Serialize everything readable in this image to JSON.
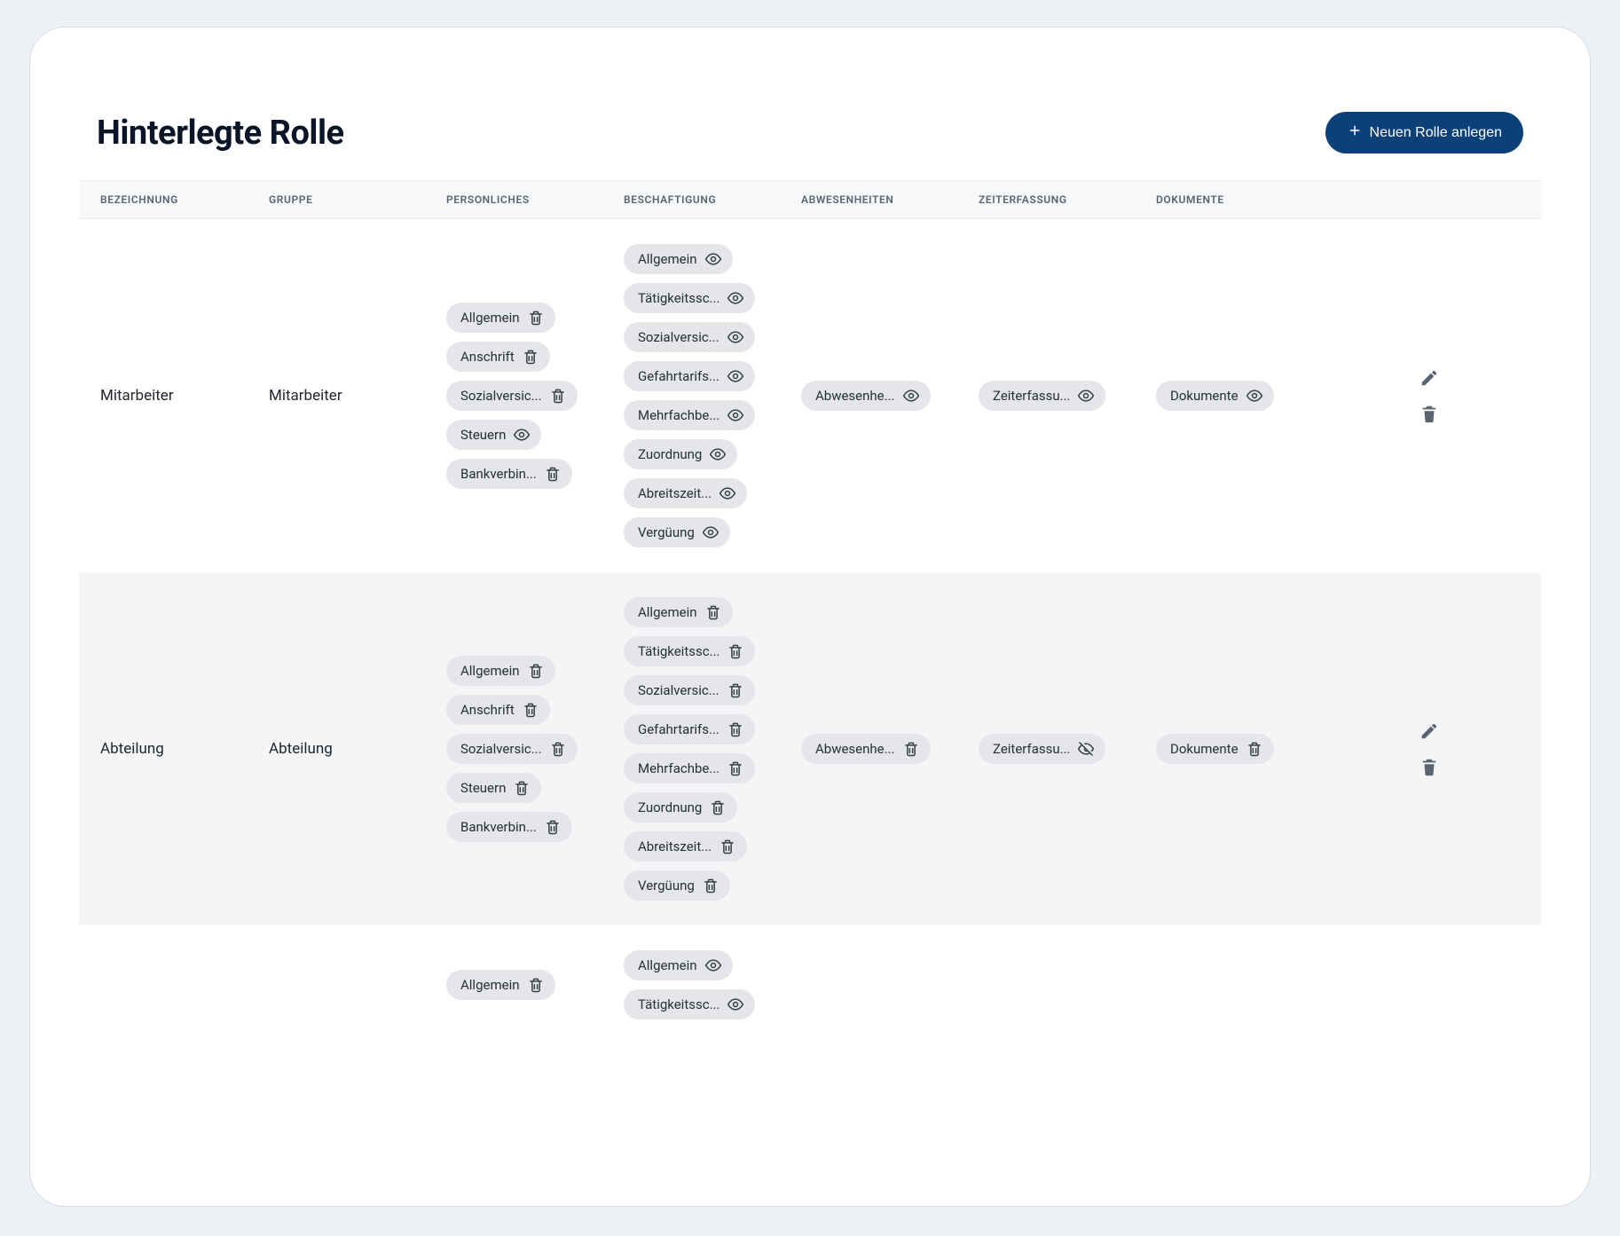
{
  "header": {
    "title": "Hinterlegte Rolle",
    "primaryButton": "Neuen Rolle anlegen"
  },
  "columns": [
    "BEZEICHNUNG",
    "GRUPPE",
    "PERSONLICHES",
    "BESCHAFTIGUNG",
    "ABWESENHEITEN",
    "ZEITERFASSUNG",
    "DOKUMENTE"
  ],
  "rows": [
    {
      "bezeichnung": "Mitarbeiter",
      "gruppe": "Mitarbeiter",
      "personliches": [
        {
          "label": "Allgemein",
          "icon": "trash"
        },
        {
          "label": "Anschrift",
          "icon": "trash"
        },
        {
          "label": "Sozialversic...",
          "icon": "trash"
        },
        {
          "label": "Steuern",
          "icon": "eye"
        },
        {
          "label": "Bankverbin...",
          "icon": "trash"
        }
      ],
      "beschaftigung": [
        {
          "label": "Allgemein",
          "icon": "eye"
        },
        {
          "label": "Tätigkeitssc...",
          "icon": "eye"
        },
        {
          "label": "Sozialversic...",
          "icon": "eye"
        },
        {
          "label": "Gefahrtarifs...",
          "icon": "eye"
        },
        {
          "label": "Mehrfachbe...",
          "icon": "eye"
        },
        {
          "label": "Zuordnung",
          "icon": "eye"
        },
        {
          "label": "Abreitszeit...",
          "icon": "eye"
        },
        {
          "label": "Vergüung",
          "icon": "eye"
        }
      ],
      "abwesenheiten": [
        {
          "label": "Abwesenhe...",
          "icon": "eye"
        }
      ],
      "zeiterfassung": [
        {
          "label": "Zeiterfassu...",
          "icon": "eye"
        }
      ],
      "dokumente": [
        {
          "label": "Dokumente",
          "icon": "eye"
        }
      ]
    },
    {
      "bezeichnung": "Abteilung",
      "gruppe": "Abteilung",
      "personliches": [
        {
          "label": "Allgemein",
          "icon": "trash"
        },
        {
          "label": "Anschrift",
          "icon": "trash"
        },
        {
          "label": "Sozialversic...",
          "icon": "trash"
        },
        {
          "label": "Steuern",
          "icon": "trash"
        },
        {
          "label": "Bankverbin...",
          "icon": "trash"
        }
      ],
      "beschaftigung": [
        {
          "label": "Allgemein",
          "icon": "trash"
        },
        {
          "label": "Tätigkeitssc...",
          "icon": "trash"
        },
        {
          "label": "Sozialversic...",
          "icon": "trash"
        },
        {
          "label": "Gefahrtarifs...",
          "icon": "trash"
        },
        {
          "label": "Mehrfachbe...",
          "icon": "trash"
        },
        {
          "label": "Zuordnung",
          "icon": "trash"
        },
        {
          "label": "Abreitszeit...",
          "icon": "trash"
        },
        {
          "label": "Vergüung",
          "icon": "trash"
        }
      ],
      "abwesenheiten": [
        {
          "label": "Abwesenhe...",
          "icon": "trash"
        }
      ],
      "zeiterfassung": [
        {
          "label": "Zeiterfassu...",
          "icon": "eye-off"
        }
      ],
      "dokumente": [
        {
          "label": "Dokumente",
          "icon": "trash"
        }
      ]
    },
    {
      "bezeichnung": "",
      "gruppe": "",
      "personliches": [
        {
          "label": "Allgemein",
          "icon": "trash"
        }
      ],
      "beschaftigung": [
        {
          "label": "Allgemein",
          "icon": "eye"
        },
        {
          "label": "Tätigkeitssc...",
          "icon": "eye"
        }
      ],
      "abwesenheiten": [],
      "zeiterfassung": [],
      "dokumente": []
    }
  ]
}
